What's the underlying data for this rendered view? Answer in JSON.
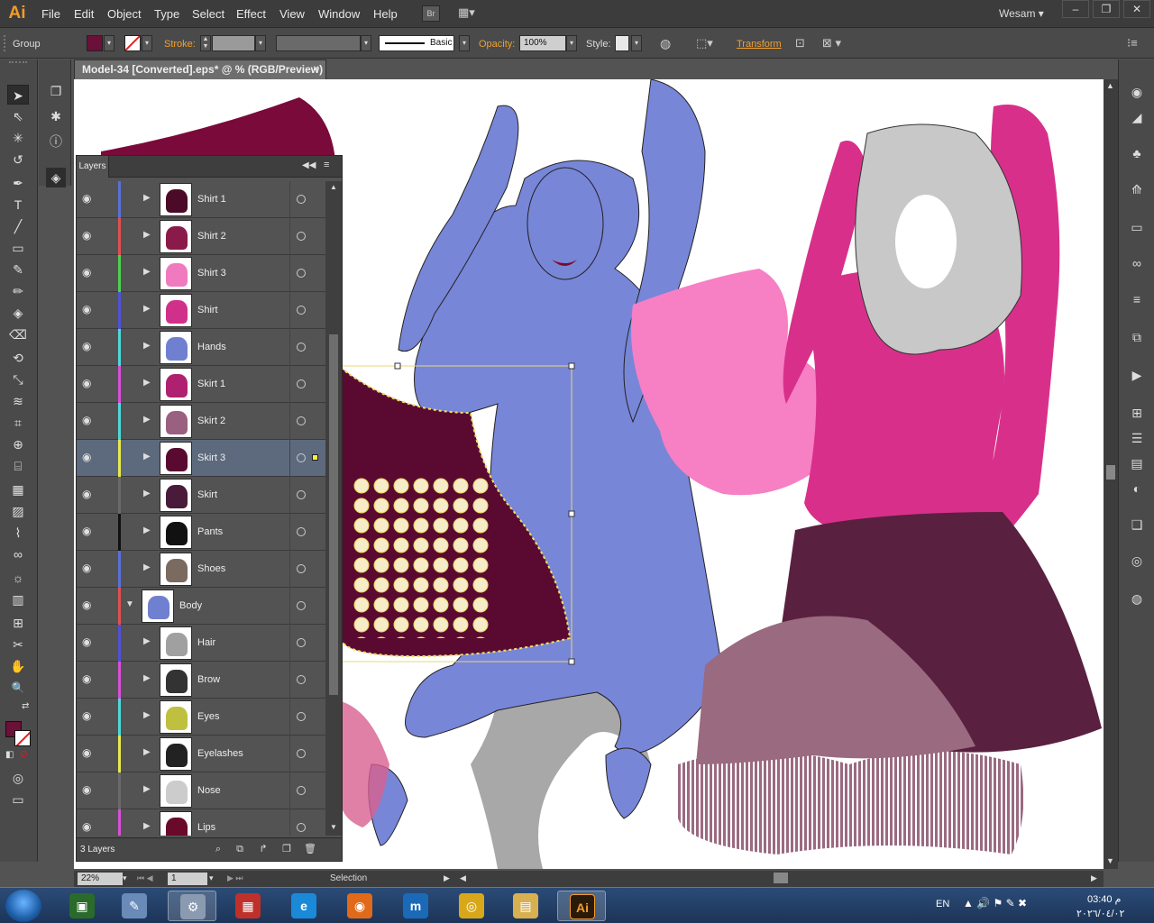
{
  "app": {
    "logo": "Ai",
    "menu": [
      "File",
      "Edit",
      "Object",
      "Type",
      "Select",
      "Effect",
      "View",
      "Window",
      "Help"
    ],
    "bridge_label": "Br",
    "user": "Wesam",
    "user_caret": "▾"
  },
  "window_controls": {
    "minimize": "–",
    "maximize": "❐",
    "close": "✕"
  },
  "control_bar": {
    "selection_type": "Group",
    "fill_color": "#6b1038",
    "stroke_label": "Stroke:",
    "stroke_style": "Basic",
    "opacity_label": "Opacity:",
    "opacity_value": "100%",
    "style_label": "Style:",
    "transform_label": "Transform"
  },
  "document": {
    "tab_title": "Model-34 [Converted].eps* @ % (RGB/Preview)",
    "close_glyph": "×"
  },
  "tools": {
    "selection": "➤",
    "direct": "⇖",
    "magic": "✳",
    "lasso": "↺",
    "pen": "✒",
    "type": "T",
    "line": "╱",
    "rect": "▭",
    "brush": "✎",
    "pencil": "✏",
    "blob": "◈",
    "eraser": "⌫",
    "rotate": "⟲",
    "scale": "⤡",
    "warp": "≋",
    "free": "⌗",
    "shape": "⊕",
    "persp": "⌸",
    "mesh": "▦",
    "grad": "▨",
    "eyedrop": "⌇",
    "blend": "∞",
    "symbol": "☼",
    "graph": "▥",
    "artboard": "⊞",
    "slice": "✂",
    "hand": "✋",
    "zoom": "🔍",
    "swap": "⇄",
    "fill_swatch": "#6b1038",
    "no_stroke": "∅",
    "default_colors": "◧",
    "draw_mode": "◎",
    "screen_mode": "▭"
  },
  "mini_tools": {
    "copy": "❐",
    "sym": "✱",
    "info": "ⓘ",
    "layers": "◈"
  },
  "dock": [
    "◉",
    "◢",
    "♣",
    "⟰",
    "▭",
    "∞",
    "≡",
    "⧉",
    "▶",
    "⊞",
    "☰",
    "▤",
    "◐",
    "❑",
    "◎",
    "◍"
  ],
  "layers_panel": {
    "tab_label": "Layers",
    "collapse_glyph": "◀◀",
    "menu_glyph": "≡",
    "eye_glyph": "◉",
    "expand_glyph": "▶",
    "collapse_row_glyph": "▼",
    "layer_count": "3 Layers",
    "footer_icons": [
      "⌕",
      "⧉",
      "↱",
      "❐",
      "🗑"
    ],
    "layers": [
      {
        "name": "Shirt 1",
        "color": "#5a6fd8",
        "thumb": "#4a0a28",
        "expanded": false,
        "selected": false
      },
      {
        "name": "Shirt 2",
        "color": "#e05050",
        "thumb": "#8a1a4a",
        "expanded": false,
        "selected": false
      },
      {
        "name": "Shirt 3",
        "color": "#50d050",
        "thumb": "#f07ac0",
        "expanded": false,
        "selected": false
      },
      {
        "name": "Shirt",
        "color": "#5050d8",
        "thumb": "#d0308a",
        "expanded": false,
        "selected": false
      },
      {
        "name": "Hands",
        "color": "#50d8d8",
        "thumb": "#7080d0",
        "expanded": false,
        "selected": false
      },
      {
        "name": "Skirt 1",
        "color": "#d850d8",
        "thumb": "#b02070",
        "expanded": false,
        "selected": false
      },
      {
        "name": "Skirt 2",
        "color": "#50d8d8",
        "thumb": "#9a6080",
        "expanded": false,
        "selected": false
      },
      {
        "name": "Skirt 3",
        "color": "#e8e850",
        "thumb": "#5a0a30",
        "expanded": false,
        "selected": true
      },
      {
        "name": "Skirt",
        "color": "#6a6a6a",
        "thumb": "#4a1a3a",
        "expanded": false,
        "selected": false
      },
      {
        "name": "Pants",
        "color": "#111111",
        "thumb": "#111111",
        "expanded": false,
        "selected": false
      },
      {
        "name": "Shoes",
        "color": "#5a6fd8",
        "thumb": "#7a6a60",
        "expanded": false,
        "selected": false
      },
      {
        "name": "Body",
        "color": "#e05050",
        "thumb": "#7080d0",
        "expanded": true,
        "selected": false
      },
      {
        "name": "Hair",
        "color": "#5050d8",
        "thumb": "#a0a0a0",
        "expanded": false,
        "selected": false
      },
      {
        "name": "Brow",
        "color": "#d850d8",
        "thumb": "#333333",
        "expanded": false,
        "selected": false
      },
      {
        "name": "Eyes",
        "color": "#50d8d8",
        "thumb": "#c0c040",
        "expanded": false,
        "selected": false
      },
      {
        "name": "Eyelashes",
        "color": "#e8e850",
        "thumb": "#222222",
        "expanded": false,
        "selected": false
      },
      {
        "name": "Nose",
        "color": "#6a6a6a",
        "thumb": "#cccccc",
        "expanded": false,
        "selected": false
      },
      {
        "name": "Lips",
        "color": "#d850d8",
        "thumb": "#6a0a2a",
        "expanded": false,
        "selected": false
      }
    ]
  },
  "status_bar": {
    "zoom": "22%",
    "page": "1",
    "tool": "Selection"
  },
  "taskbar": {
    "apps": [
      {
        "name": "terminal",
        "glyph": "▣",
        "color": "#2a6a2a",
        "active": false
      },
      {
        "name": "paint",
        "glyph": "✎",
        "color": "#6a8ab8",
        "active": false
      },
      {
        "name": "tools",
        "glyph": "⚙",
        "color": "#8a9ab0",
        "active": true
      },
      {
        "name": "studio",
        "glyph": "▦",
        "color": "#c0302a",
        "active": false
      },
      {
        "name": "edge",
        "glyph": "e",
        "color": "#1a8ad8",
        "active": false
      },
      {
        "name": "firefox",
        "glyph": "◉",
        "color": "#e06a1a",
        "active": false
      },
      {
        "name": "m",
        "glyph": "m",
        "color": "#1a6ab8",
        "active": false
      },
      {
        "name": "chrome",
        "glyph": "◎",
        "color": "#d8a81a",
        "active": false
      },
      {
        "name": "explorer",
        "glyph": "▤",
        "color": "#d8b050",
        "active": false
      },
      {
        "name": "illustrator",
        "glyph": "Ai",
        "color": "#2a1a0a",
        "active": true
      }
    ],
    "language": "EN",
    "tray": "▲ 🔊 ⚑ ✎ ✖",
    "time": "03:40 م",
    "date": "٢٠٢٦/٠٤/٠٢"
  }
}
